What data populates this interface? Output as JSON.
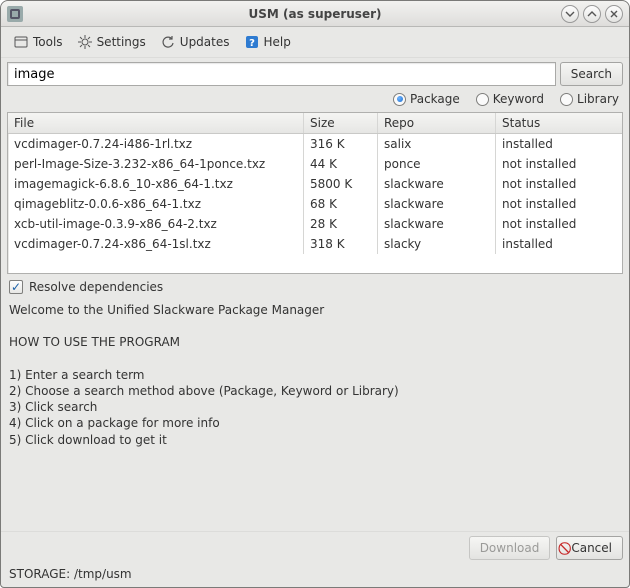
{
  "window": {
    "title": "USM (as superuser)"
  },
  "menus": {
    "tools": "Tools",
    "settings": "Settings",
    "updates": "Updates",
    "help": "Help"
  },
  "search": {
    "value": "image",
    "button": "Search"
  },
  "filters": {
    "package": "Package",
    "keyword": "Keyword",
    "library": "Library",
    "selected": "package"
  },
  "table": {
    "headers": {
      "file": "File",
      "size": "Size",
      "repo": "Repo",
      "status": "Status"
    },
    "rows": [
      {
        "file": "vcdimager-0.7.24-i486-1rl.txz",
        "size": "316 K",
        "repo": "salix",
        "status": "installed"
      },
      {
        "file": "perl-Image-Size-3.232-x86_64-1ponce.txz",
        "size": "44 K",
        "repo": "ponce",
        "status": "not installed"
      },
      {
        "file": "imagemagick-6.8.6_10-x86_64-1.txz",
        "size": "5800 K",
        "repo": "slackware",
        "status": "not installed"
      },
      {
        "file": "qimageblitz-0.0.6-x86_64-1.txz",
        "size": "68 K",
        "repo": "slackware",
        "status": "not installed"
      },
      {
        "file": "xcb-util-image-0.3.9-x86_64-2.txz",
        "size": "28 K",
        "repo": "slackware",
        "status": "not installed"
      },
      {
        "file": "vcdimager-0.7.24-x86_64-1sl.txz",
        "size": "318 K",
        "repo": "slacky",
        "status": "installed"
      }
    ]
  },
  "resolve_deps": {
    "label": "Resolve dependencies",
    "checked": true
  },
  "info_text": "Welcome to the Unified Slackware Package Manager\n\nHOW TO USE THE PROGRAM\n\n1) Enter a search term\n2) Choose a search method above (Package, Keyword or Library)\n3) Click search\n4) Click on a package for more info\n5) Click download to get it",
  "buttons": {
    "download": "Download",
    "cancel": "Cancel"
  },
  "statusbar": "STORAGE: /tmp/usm"
}
